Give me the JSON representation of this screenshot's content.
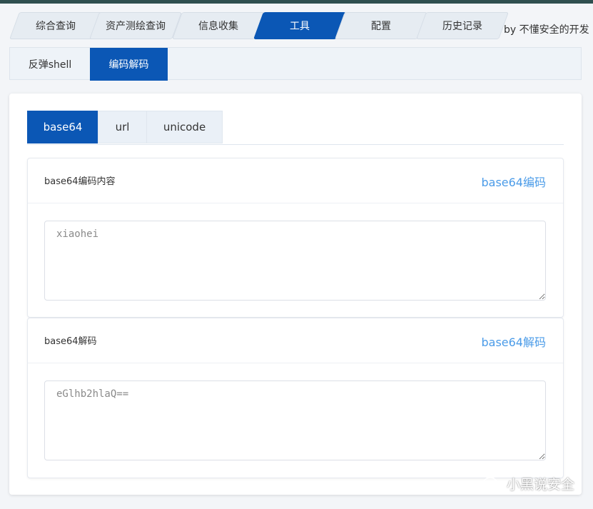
{
  "top_tabs": [
    {
      "label": "综合查询",
      "active": false
    },
    {
      "label": "资产测绘查询",
      "active": false
    },
    {
      "label": "信息收集",
      "active": false
    },
    {
      "label": "工具",
      "active": true
    },
    {
      "label": "配置",
      "active": false
    },
    {
      "label": "历史记录",
      "active": false
    }
  ],
  "byline": "by 不懂安全的开发",
  "sub_tabs": [
    {
      "label": "反弹shell",
      "active": false
    },
    {
      "label": "编码解码",
      "active": true
    }
  ],
  "inner_tabs": [
    {
      "label": "base64",
      "active": true
    },
    {
      "label": "url",
      "active": false
    },
    {
      "label": "unicode",
      "active": false
    }
  ],
  "encode_card": {
    "title": "base64编码内容",
    "action": "base64编码",
    "placeholder": "xiaohei"
  },
  "decode_card": {
    "title": "base64解码",
    "action": "base64解码",
    "placeholder": "eGlhb2hlaQ=="
  },
  "watermark": "小黑说安全",
  "colors": {
    "accent": "#0b57b5",
    "link": "#4a9be8",
    "tab_bg": "#e6ecf2"
  }
}
